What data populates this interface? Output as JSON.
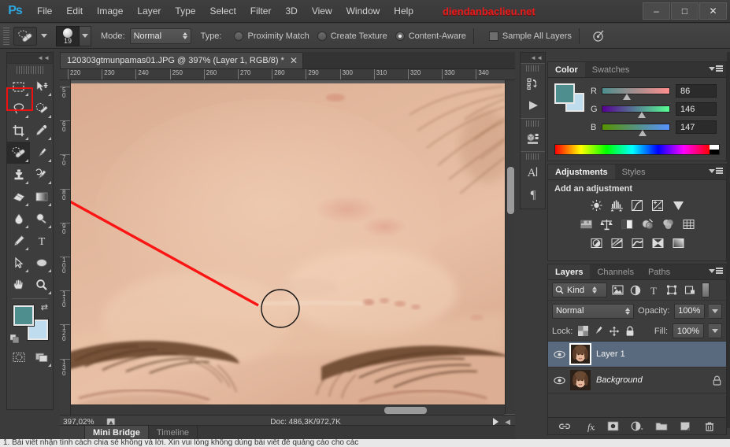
{
  "app": {
    "logo": "Ps",
    "watermark": "diendanbaclieu.net",
    "menus": [
      "File",
      "Edit",
      "Image",
      "Layer",
      "Type",
      "Select",
      "Filter",
      "3D",
      "View",
      "Window",
      "Help"
    ],
    "window_controls": {
      "minimize": "–",
      "maximize": "□",
      "close": "✕"
    }
  },
  "options_bar": {
    "tool_icon": "spot-healing-brush-icon",
    "brush_size": "19",
    "mode_label": "Mode:",
    "mode_value": "Normal",
    "type_label": "Type:",
    "type_options": [
      {
        "label": "Proximity Match",
        "selected": false
      },
      {
        "label": "Create Texture",
        "selected": false
      },
      {
        "label": "Content-Aware",
        "selected": true
      }
    ],
    "sample_all_layers": {
      "label": "Sample All Layers",
      "checked": false
    },
    "tablet_pressure_icon": "airbrush-pressure-icon"
  },
  "toolbar": {
    "tools": [
      {
        "name": "rectangular-marquee",
        "row": 0,
        "col": 0
      },
      {
        "name": "move",
        "row": 0,
        "col": 1
      },
      {
        "name": "lasso",
        "row": 1,
        "col": 0
      },
      {
        "name": "quick-selection",
        "row": 1,
        "col": 1
      },
      {
        "name": "crop",
        "row": 2,
        "col": 0
      },
      {
        "name": "eyedropper",
        "row": 2,
        "col": 1
      },
      {
        "name": "spot-healing-brush",
        "row": 3,
        "col": 0,
        "selected": true
      },
      {
        "name": "brush",
        "row": 3,
        "col": 1
      },
      {
        "name": "clone-stamp",
        "row": 4,
        "col": 0
      },
      {
        "name": "history-brush",
        "row": 4,
        "col": 1
      },
      {
        "name": "eraser",
        "row": 5,
        "col": 0
      },
      {
        "name": "gradient",
        "row": 5,
        "col": 1
      },
      {
        "name": "blur",
        "row": 6,
        "col": 0
      },
      {
        "name": "dodge",
        "row": 6,
        "col": 1
      },
      {
        "name": "pen",
        "row": 7,
        "col": 0
      },
      {
        "name": "horizontal-type",
        "row": 7,
        "col": 1
      },
      {
        "name": "path-selection",
        "row": 8,
        "col": 0
      },
      {
        "name": "ellipse-shape",
        "row": 8,
        "col": 1
      },
      {
        "name": "hand",
        "row": 9,
        "col": 0
      },
      {
        "name": "zoom",
        "row": 9,
        "col": 1
      }
    ],
    "foreground_color": "#4e8e8e",
    "background_color": "#bedcee",
    "quick_mask_label": "Edit in Quick Mask Mode",
    "screen_mode_label": "Change Screen Mode"
  },
  "document": {
    "tab_title": "120303gtmunpamas01.JPG @ 397% (Layer 1, RGB/8) *",
    "close_glyph": "✕",
    "ruler_h": [
      "220",
      "230",
      "240",
      "250",
      "260",
      "270",
      "280",
      "290",
      "300",
      "310",
      "320",
      "330",
      "340"
    ],
    "ruler_v": [
      "50",
      "60",
      "70",
      "80",
      "90",
      "100",
      "110",
      "120",
      "130"
    ],
    "annotation": {
      "type": "red-pointer-line",
      "cursor": "brush-circle-cursor"
    }
  },
  "status_bar": {
    "zoom": "397,02%",
    "doc_info": "Doc: 486,3K/972,7K",
    "preview_icon": "preview-icon"
  },
  "bottom_tabs": [
    {
      "label": "Mini Bridge",
      "active": true
    },
    {
      "label": "Timeline",
      "active": false
    }
  ],
  "footer_text": "1. Bài viết nhận tính cách chia sẻ không và lời. Xin vui lòng không dùng bài viết để quảng cáo cho các",
  "icon_dock": [
    {
      "name": "history-icon"
    },
    {
      "name": "actions-play-icon"
    },
    {
      "name": "3d-icon"
    },
    {
      "name": "character-icon"
    },
    {
      "name": "paragraph-icon"
    }
  ],
  "color_panel": {
    "tabs": [
      {
        "label": "Color",
        "active": true
      },
      {
        "label": "Swatches",
        "active": false
      }
    ],
    "foreground": "#4e8e8e",
    "background": "#bedcee",
    "channels": [
      {
        "label": "R",
        "value": "86",
        "pct": 34
      },
      {
        "label": "G",
        "value": "146",
        "pct": 57
      },
      {
        "label": "B",
        "value": "147",
        "pct": 58
      }
    ]
  },
  "adjustments_panel": {
    "tabs": [
      {
        "label": "Adjustments",
        "active": true
      },
      {
        "label": "Styles",
        "active": false
      }
    ],
    "title": "Add an adjustment",
    "rows": [
      [
        "brightness-contrast-icon",
        "levels-icon",
        "curves-icon",
        "exposure-icon",
        "vibrance-icon"
      ],
      [
        "hue-saturation-icon",
        "color-balance-icon",
        "black-white-icon",
        "photo-filter-icon",
        "channel-mixer-icon",
        "color-lookup-icon"
      ],
      [
        "invert-icon",
        "posterize-icon",
        "threshold-icon",
        "gradient-map-icon",
        "selective-color-icon"
      ]
    ]
  },
  "layers_panel": {
    "tabs": [
      {
        "label": "Layers",
        "active": true
      },
      {
        "label": "Channels",
        "active": false
      },
      {
        "label": "Paths",
        "active": false
      }
    ],
    "filter_label": "Kind",
    "filter_icons": [
      "pixel-filter-icon",
      "adjustment-filter-icon",
      "type-filter-icon",
      "shape-filter-icon",
      "smart-object-filter-icon"
    ],
    "blend_mode": "Normal",
    "opacity_label": "Opacity:",
    "opacity_value": "100%",
    "lock_label": "Lock:",
    "lock_icons": [
      "lock-transparent-icon",
      "lock-image-icon",
      "lock-position-icon",
      "lock-all-icon"
    ],
    "fill_label": "Fill:",
    "fill_value": "100%",
    "layers": [
      {
        "name": "Layer 1",
        "selected": true,
        "italic": false,
        "locked": false,
        "visible": true
      },
      {
        "name": "Background",
        "selected": false,
        "italic": true,
        "locked": true,
        "visible": true
      }
    ],
    "footer_icons": [
      "link-layers-icon",
      "layer-style-fx-icon",
      "add-mask-icon",
      "new-adjustment-icon",
      "new-group-icon",
      "new-layer-icon",
      "delete-layer-icon"
    ],
    "fx_label": "fx"
  }
}
